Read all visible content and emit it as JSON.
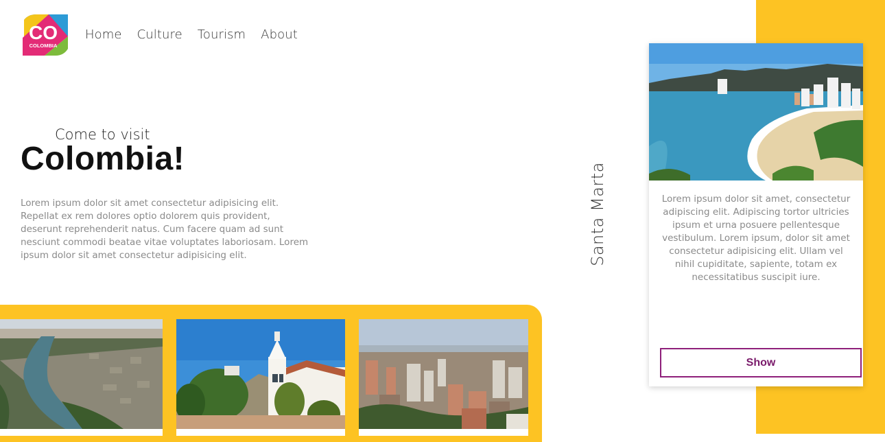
{
  "logo": {
    "mark": "CO",
    "word": "COLOMBIA"
  },
  "nav": [
    "Home",
    "Culture",
    "Tourism",
    "About"
  ],
  "hero": {
    "subtitle": "Come to visit",
    "title": "Colombia!",
    "description": "Lorem ipsum dolor sit amet consectetur adipisicing elit. Repellat ex rem dolores optio dolorem quis provident, deserunt reprehenderit natus. Cum facere quam ad sunt nesciunt commodi beatae vitae voluptates laboriosam. Lorem ipsum dolor sit amet consectetur adipisicing elit."
  },
  "featured": {
    "label": "Santa Marta",
    "description": "Lorem ipsum dolor sit amet, consectetur adipiscing elit. Adipiscing tortor ultricies ipsum et urna posuere pellentesque vestibulum. Lorem ipsum, dolor sit amet consectetur adipisicing elit. Ullam vel nihil cupiditate, sapiente, totam ex necessitatibus suscipit iure.",
    "button": "Show"
  },
  "colors": {
    "accent_yellow": "#fdc323",
    "button_purple": "#8e1f7a"
  },
  "icons": [
    "colombia-logo-icon"
  ]
}
